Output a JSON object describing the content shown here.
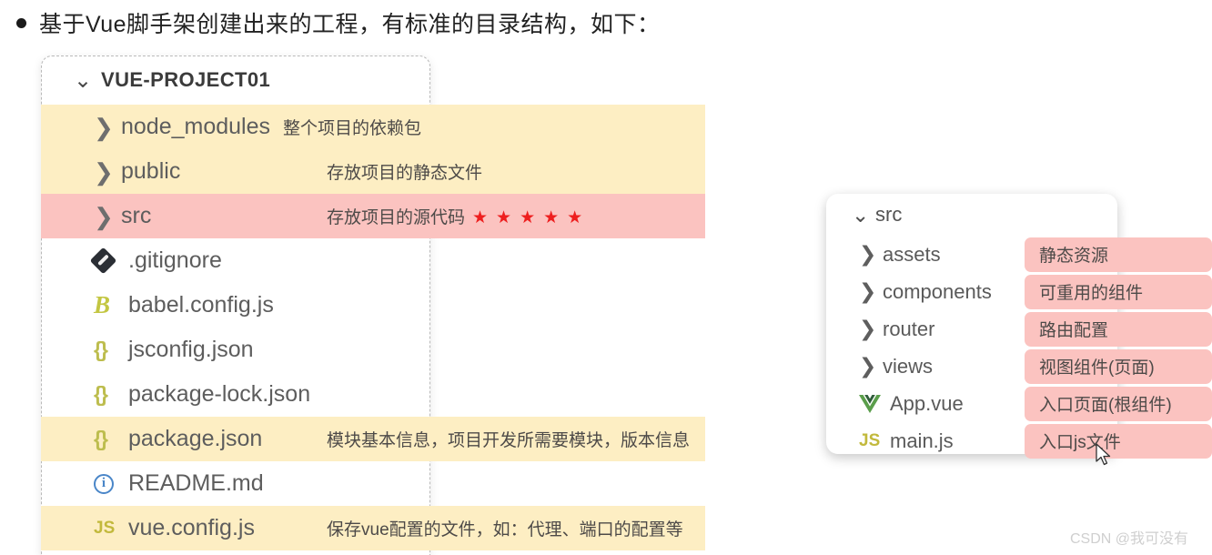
{
  "headline": {
    "bullet_icon": "filled-circle-bullet",
    "text": "基于Vue脚手架创建出来的工程，有标准的目录结构，如下："
  },
  "left_panel": {
    "project_name": "VUE-PROJECT01",
    "expand_icon": "chevron-down-icon",
    "colors": {
      "highlight_yellow": "#fdeec3",
      "highlight_pink": "#fbc3c0",
      "star_red": "#ee1f1f"
    },
    "rows": [
      {
        "name": "node_modules",
        "note": "整个项目的依赖包",
        "icon": "chevron-right-icon",
        "kind": "folder",
        "highlight": "yellow",
        "stars": 0
      },
      {
        "name": "public",
        "note": "存放项目的静态文件",
        "icon": "chevron-right-icon",
        "kind": "folder",
        "highlight": "yellow",
        "stars": 0
      },
      {
        "name": "src",
        "note": "存放项目的源代码",
        "icon": "chevron-right-icon",
        "kind": "folder",
        "highlight": "pink",
        "stars": 5
      },
      {
        "name": ".gitignore",
        "note": "",
        "icon": "git-file-icon",
        "kind": "file",
        "highlight": "none",
        "stars": 0
      },
      {
        "name": "babel.config.js",
        "note": "",
        "icon": "babel-icon",
        "kind": "file",
        "highlight": "none",
        "stars": 0
      },
      {
        "name": "jsconfig.json",
        "note": "",
        "icon": "json-braces-icon",
        "kind": "file",
        "highlight": "none",
        "stars": 0
      },
      {
        "name": "package-lock.json",
        "note": "",
        "icon": "json-braces-icon",
        "kind": "file",
        "highlight": "none",
        "stars": 0
      },
      {
        "name": "package.json",
        "note": "模块基本信息，项目开发所需要模块，版本信息",
        "icon": "json-braces-icon",
        "kind": "file",
        "highlight": "yellow",
        "stars": 0
      },
      {
        "name": "README.md",
        "note": "",
        "icon": "info-circle-icon",
        "kind": "file",
        "highlight": "none",
        "stars": 0
      },
      {
        "name": "vue.config.js",
        "note": "保存vue配置的文件，如：代理、端口的配置等",
        "icon": "js-file-icon",
        "kind": "file",
        "highlight": "yellow",
        "stars": 0
      }
    ]
  },
  "right_panel": {
    "root_name": "src",
    "expand_icon": "chevron-down-icon",
    "tag_color": "#fbc3c0",
    "rows": [
      {
        "name": "assets",
        "tag": "静态资源",
        "icon": "chevron-right-icon",
        "kind": "folder"
      },
      {
        "name": "components",
        "tag": "可重用的组件",
        "icon": "chevron-right-icon",
        "kind": "folder"
      },
      {
        "name": "router",
        "tag": "路由配置",
        "icon": "chevron-right-icon",
        "kind": "folder"
      },
      {
        "name": "views",
        "tag": "视图组件(页面)",
        "icon": "chevron-right-icon",
        "kind": "folder"
      },
      {
        "name": "App.vue",
        "tag": "入口页面(根组件)",
        "icon": "vue-logo-icon",
        "kind": "file"
      },
      {
        "name": "main.js",
        "tag": "入口js文件",
        "icon": "js-file-icon",
        "kind": "file"
      }
    ]
  },
  "cursor": {
    "icon": "mouse-pointer-icon"
  },
  "watermark": {
    "text": "CSDN @我可没有"
  },
  "glyphs": {
    "chevron_right": "❯",
    "chevron_down": "⌄",
    "json_braces": "{}",
    "js_label": "JS",
    "babel_letter": "B",
    "info_letter": "i",
    "star": "★"
  }
}
